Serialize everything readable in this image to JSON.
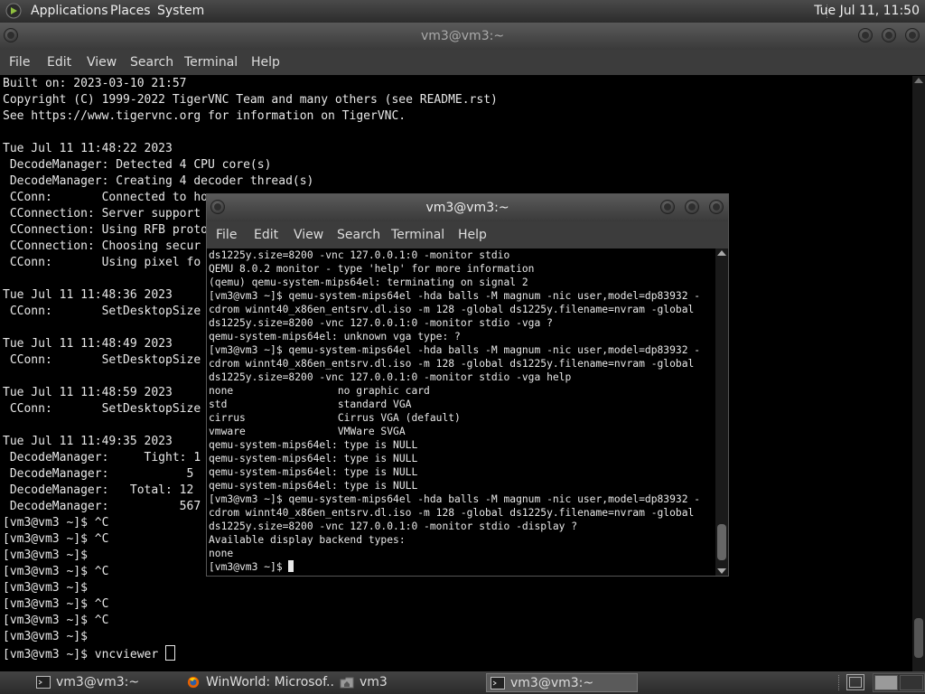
{
  "top_panel": {
    "menus": [
      "Applications",
      "Places",
      "System"
    ],
    "clock": "Tue Jul 11, 11:50"
  },
  "main_window": {
    "title": "vm3@vm3:~",
    "menu": [
      "File",
      "Edit",
      "View",
      "Search",
      "Terminal",
      "Help"
    ],
    "lines": [
      "Built on: 2023-03-10 21:57",
      "Copyright (C) 1999-2022 TigerVNC Team and many others (see README.rst)",
      "See https://www.tigervnc.org for information on TigerVNC.",
      "",
      "Tue Jul 11 11:48:22 2023",
      " DecodeManager: Detected 4 CPU core(s)",
      " DecodeManager: Creating 4 decoder thread(s)",
      " CConn:       Connected to ho",
      " CConnection: Server support",
      " CConnection: Using RFB proto",
      " CConnection: Choosing secur",
      " CConn:       Using pixel fo",
      "",
      "Tue Jul 11 11:48:36 2023",
      " CConn:       SetDesktopSize",
      "",
      "Tue Jul 11 11:48:49 2023",
      " CConn:       SetDesktopSize",
      "",
      "Tue Jul 11 11:48:59 2023",
      " CConn:       SetDesktopSize",
      "",
      "Tue Jul 11 11:49:35 2023",
      " DecodeManager:     Tight: 1",
      " DecodeManager:           5",
      " DecodeManager:   Total: 12",
      " DecodeManager:          567",
      "[vm3@vm3 ~]$ ^C",
      "[vm3@vm3 ~]$ ^C",
      "[vm3@vm3 ~]$",
      "[vm3@vm3 ~]$ ^C",
      "[vm3@vm3 ~]$",
      "[vm3@vm3 ~]$ ^C",
      "[vm3@vm3 ~]$ ^C",
      "[vm3@vm3 ~]$",
      "[vm3@vm3 ~]$ vncviewer "
    ]
  },
  "qemu_window": {
    "title": "vm3@vm3:~",
    "menu": [
      "File",
      "Edit",
      "View",
      "Search",
      "Terminal",
      "Help"
    ],
    "lines": [
      "ds1225y.size=8200 -vnc 127.0.0.1:0 -monitor stdio",
      "QEMU 8.0.2 monitor - type 'help' for more information",
      "(qemu) qemu-system-mips64el: terminating on signal 2",
      "[vm3@vm3 ~]$ qemu-system-mips64el -hda balls -M magnum -nic user,model=dp83932 -",
      "cdrom winnt40_x86en_entsrv.dl.iso -m 128 -global ds1225y.filename=nvram -global",
      "ds1225y.size=8200 -vnc 127.0.0.1:0 -monitor stdio -vga ?",
      "qemu-system-mips64el: unknown vga type: ?",
      "[vm3@vm3 ~]$ qemu-system-mips64el -hda balls -M magnum -nic user,model=dp83932 -",
      "cdrom winnt40_x86en_entsrv.dl.iso -m 128 -global ds1225y.filename=nvram -global",
      "ds1225y.size=8200 -vnc 127.0.0.1:0 -monitor stdio -vga help",
      "none                 no graphic card",
      "std                  standard VGA",
      "cirrus               Cirrus VGA (default)",
      "vmware               VMWare SVGA",
      "qemu-system-mips64el: type is NULL",
      "qemu-system-mips64el: type is NULL",
      "qemu-system-mips64el: type is NULL",
      "qemu-system-mips64el: type is NULL",
      "[vm3@vm3 ~]$ qemu-system-mips64el -hda balls -M magnum -nic user,model=dp83932 -",
      "cdrom winnt40_x86en_entsrv.dl.iso -m 128 -global ds1225y.filename=nvram -global",
      "ds1225y.size=8200 -vnc 127.0.0.1:0 -monitor stdio -display ?",
      "Available display backend types:",
      "none",
      "[vm3@vm3 ~]$ "
    ]
  },
  "taskbar": {
    "tasks": [
      {
        "label": "vm3@vm3:~",
        "icon": "terminal-icon",
        "active": false
      },
      {
        "label": "WinWorld: Microsof...",
        "icon": "firefox-icon",
        "active": false
      },
      {
        "label": "vm3",
        "icon": "folder-home-icon",
        "active": false
      },
      {
        "label": "vm3@vm3:~",
        "icon": "terminal-icon",
        "active": true
      }
    ]
  },
  "colors": {
    "terminal_bg": "#000000",
    "terminal_fg": "#e8e8e8",
    "panel_bg": "#3a3a3a",
    "menubar_bg": "#3c3c3c"
  }
}
